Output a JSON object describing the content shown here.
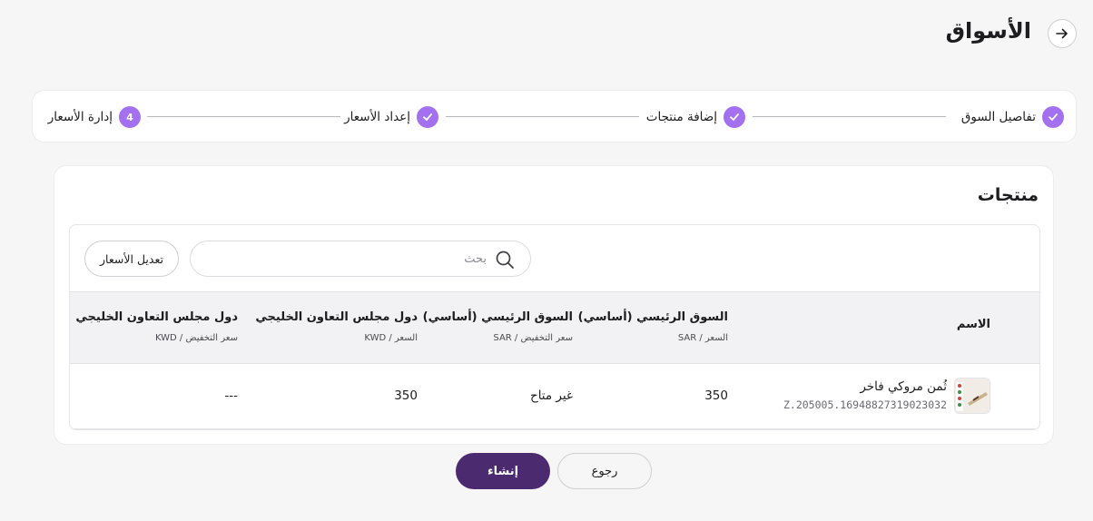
{
  "header": {
    "title": "الأسواق",
    "back_icon": "arrow-right-icon"
  },
  "stepper": {
    "accent_color": "#a371f0",
    "steps": [
      {
        "label": "تفاصيل السوق",
        "state": "completed"
      },
      {
        "label": "إضافة منتجات",
        "state": "completed"
      },
      {
        "label": "إعداد الأسعار",
        "state": "completed"
      },
      {
        "label": "إدارة الأسعار",
        "state": "current",
        "number": "4"
      }
    ]
  },
  "products": {
    "title": "منتجات",
    "search": {
      "placeholder": "بحث",
      "value": ""
    },
    "edit_prices_label": "تعديل الأسعار",
    "columns": [
      {
        "label": "الاسم",
        "sub": ""
      },
      {
        "label": "السوق الرئيسي (أساسي)",
        "sub": "السعر / SAR"
      },
      {
        "label": "السوق الرئيسي (أساسي)",
        "sub": "سعر التخفيض / SAR"
      },
      {
        "label": "دول مجلس التعاون الخليجي",
        "sub": "السعر / KWD"
      },
      {
        "label": "دول مجلس التعاون الخليجي",
        "sub": "سعر التخفيض / KWD"
      }
    ],
    "rows": [
      {
        "name": "ثُمن مروكي فاخر",
        "sku": "Z.205005.16948827319023032",
        "main_price": "350",
        "main_discount": "غير متاح",
        "gcc_price": "350",
        "gcc_discount": "---"
      }
    ]
  },
  "footer": {
    "create_label": "إنشاء",
    "back_label": "رجوع",
    "primary_color": "#4b2a70"
  }
}
